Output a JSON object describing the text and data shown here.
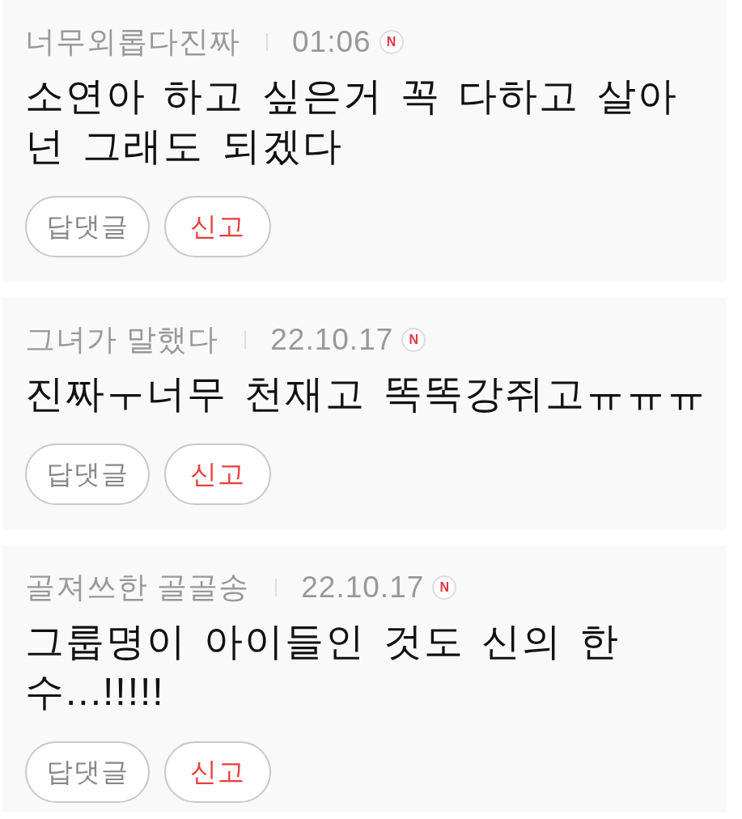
{
  "comments": [
    {
      "author": "너무외롭다진짜",
      "time": "01:06",
      "badge": "N",
      "text": "소연아 하고 싶은거 꼭 다하고 살아 넌 그래도 되겠다",
      "actions": [
        {
          "kind": "reply",
          "label": "답댓글"
        },
        {
          "kind": "report",
          "label": "신고"
        }
      ]
    },
    {
      "author": "그녀가 말했다",
      "time": "22.10.17",
      "badge": "N",
      "text": "진짜ㅜ너무 천재고 똑똑강쥐고ㅠㅠㅠ",
      "actions": [
        {
          "kind": "reply",
          "label": "답댓글"
        },
        {
          "kind": "report",
          "label": "신고"
        }
      ]
    },
    {
      "author": "골져쓰한 골골송",
      "time": "22.10.17",
      "badge": "N",
      "text": "그룹명이 아이들인 것도 신의 한 수...!!!!!",
      "actions": [
        {
          "kind": "reply",
          "label": "답댓글"
        },
        {
          "kind": "report",
          "label": "신고"
        }
      ]
    }
  ]
}
